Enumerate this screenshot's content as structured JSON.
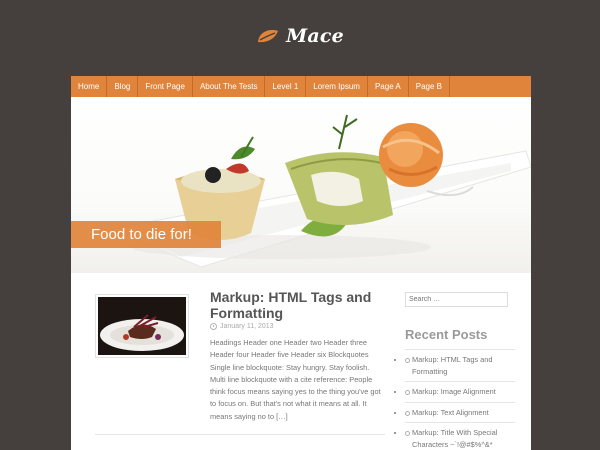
{
  "site": {
    "title": "Mace"
  },
  "nav": {
    "items": [
      "Home",
      "Blog",
      "Front Page",
      "About The Tests",
      "Level 1",
      "Lorem Ipsum",
      "Page A",
      "Page B"
    ]
  },
  "hero": {
    "caption": "Food to die for!"
  },
  "post": {
    "title": "Markup: HTML Tags and Formatting",
    "date": "January 11, 2013",
    "excerpt": "Headings Header one Header two Header three Header four Header five Header six Blockquotes Single line blockquote: Stay hungry. Stay foolish. Multi line blockquote with a cite reference: People think focus means saying yes to the thing you've got to focus on. But that's not what it means at all. It means saying no to […]"
  },
  "sidebar": {
    "search_placeholder": "Search …",
    "heading": "Recent Posts",
    "recent": [
      "Markup: HTML Tags and Formatting",
      "Markup: Image Alignment",
      "Markup: Text Alignment",
      "Markup: Title With Special Characters ~`!@#$%^&*"
    ]
  },
  "colors": {
    "background": "#45403d",
    "accent": "#e0843b",
    "text": "#555555"
  },
  "icons": {
    "logo": "leaf-icon",
    "date": "clock-icon"
  }
}
